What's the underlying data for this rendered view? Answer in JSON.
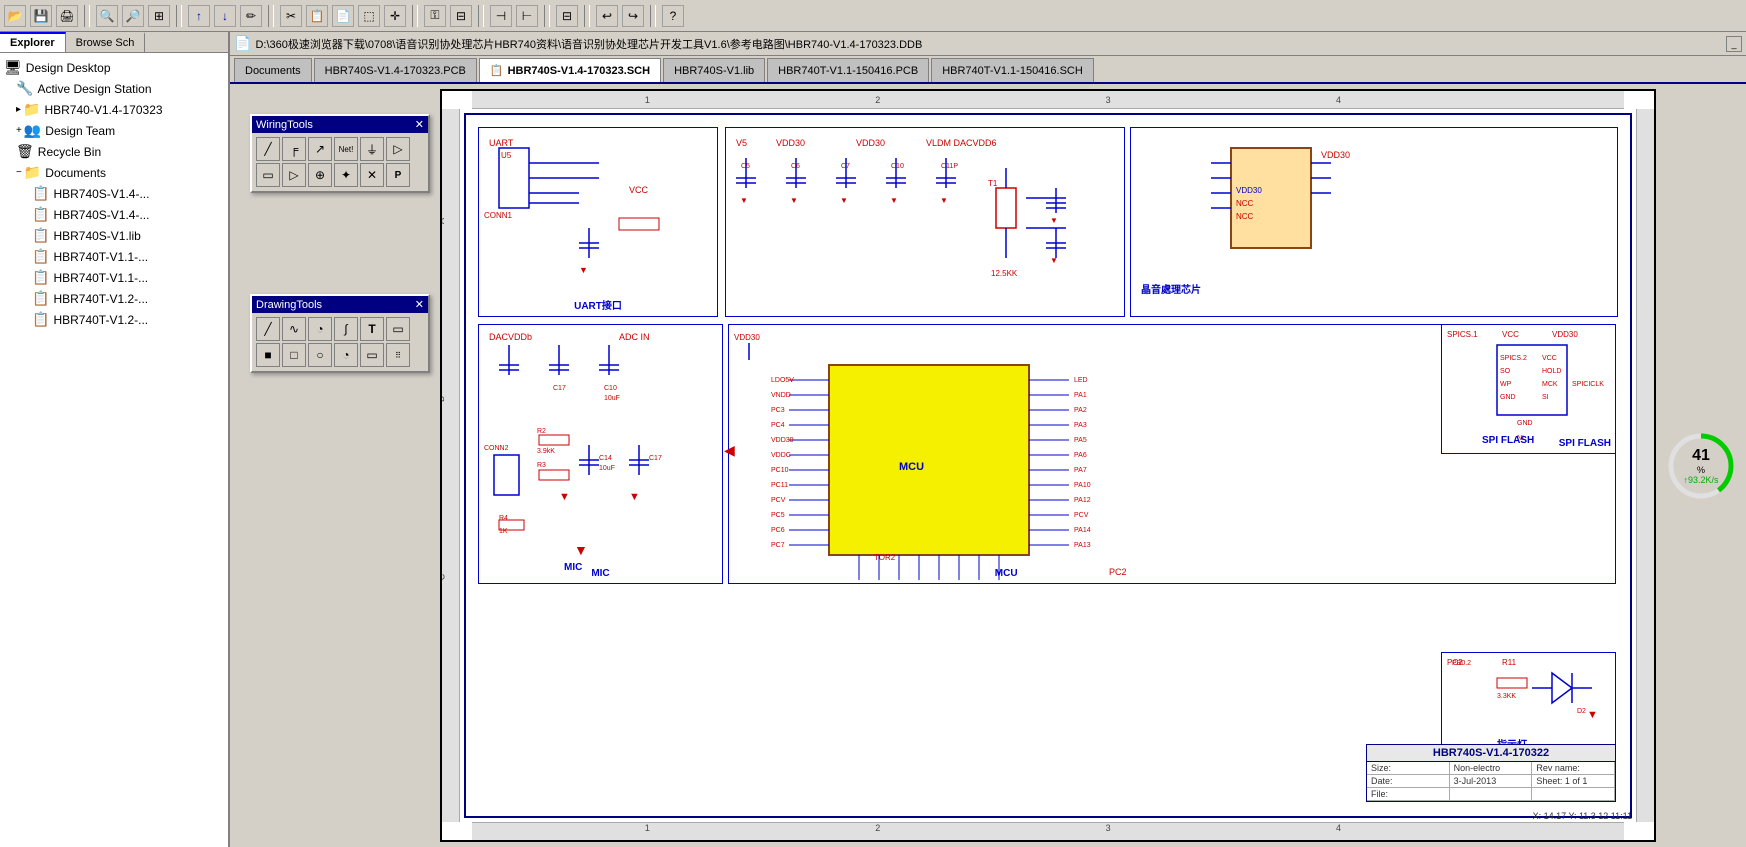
{
  "toolbar": {
    "buttons": [
      {
        "name": "open-icon",
        "symbol": "📂"
      },
      {
        "name": "save-icon",
        "symbol": "💾"
      },
      {
        "name": "print-icon",
        "symbol": "🖨"
      },
      {
        "name": "zoom-in-icon",
        "symbol": "🔍"
      },
      {
        "name": "zoom-out-icon",
        "symbol": "🔎"
      },
      {
        "name": "zoom-fit-icon",
        "symbol": "⊞"
      },
      {
        "name": "up-arrow-icon",
        "symbol": "↑"
      },
      {
        "name": "pencil-icon",
        "symbol": "✏"
      },
      {
        "name": "undo-icon",
        "symbol": "↩"
      },
      {
        "name": "redo-icon",
        "symbol": "↪"
      },
      {
        "name": "help-icon",
        "symbol": "?"
      }
    ]
  },
  "sidebar": {
    "tabs": [
      {
        "label": "Explorer",
        "active": true
      },
      {
        "label": "Browse Sch",
        "active": false
      }
    ],
    "tree": [
      {
        "label": "Design Desktop",
        "level": 0,
        "icon": "🖥",
        "expand": ""
      },
      {
        "label": "Active Design Station",
        "level": 1,
        "icon": "🔧",
        "expand": ""
      },
      {
        "label": "HBR740-V1.4-170323",
        "level": 1,
        "icon": "📁",
        "expand": ""
      },
      {
        "label": "Design Team",
        "level": 1,
        "icon": "👥",
        "expand": "+"
      },
      {
        "label": "Recycle Bin",
        "level": 1,
        "icon": "🗑",
        "expand": ""
      },
      {
        "label": "Documents",
        "level": 1,
        "icon": "📁",
        "expand": "-"
      },
      {
        "label": "HBR740S-V1.4-...",
        "level": 2,
        "icon": "📋",
        "expand": ""
      },
      {
        "label": "HBR740S-V1.4-...",
        "level": 2,
        "icon": "📋",
        "expand": ""
      },
      {
        "label": "HBR740S-V1.lib",
        "level": 2,
        "icon": "📋",
        "expand": ""
      },
      {
        "label": "HBR740T-V1.1-...",
        "level": 2,
        "icon": "📋",
        "expand": ""
      },
      {
        "label": "HBR740T-V1.1-...",
        "level": 2,
        "icon": "📋",
        "expand": ""
      },
      {
        "label": "HBR740T-V1.2-...",
        "level": 2,
        "icon": "📋",
        "expand": ""
      },
      {
        "label": "HBR740T-V1.2-...",
        "level": 2,
        "icon": "📋",
        "expand": ""
      }
    ]
  },
  "path_bar": {
    "path": "D:\\360极速浏览器下载\\0708\\语音识别协处理芯片HBR740资料\\语音识别协处理芯片开发工具V1.6\\参考电路图\\HBR740-V1.4-170323.DDB"
  },
  "doc_tabs": [
    {
      "label": "Documents",
      "active": false,
      "icon": ""
    },
    {
      "label": "HBR740S-V1.4-170323.PCB",
      "active": false,
      "icon": ""
    },
    {
      "label": "HBR740S-V1.4-170323.SCH",
      "active": true,
      "icon": "📋"
    },
    {
      "label": "HBR740S-V1.lib",
      "active": false,
      "icon": ""
    },
    {
      "label": "HBR740T-V1.1-150416.PCB",
      "active": false,
      "icon": ""
    },
    {
      "label": "HBR740T-V1.1-150416.SCH",
      "active": false,
      "icon": ""
    }
  ],
  "wiring_tools": {
    "title": "WiringTools",
    "tools": [
      {
        "name": "wire-tool",
        "symbol": "╱"
      },
      {
        "name": "bus-tool",
        "symbol": "╒"
      },
      {
        "name": "bus-entry-tool",
        "symbol": "↗"
      },
      {
        "name": "net-label-tool",
        "symbol": "Net!"
      },
      {
        "name": "power-tool",
        "symbol": "⏚"
      },
      {
        "name": "port-tool",
        "symbol": "▷"
      },
      {
        "name": "rect-tool",
        "symbol": "▭"
      },
      {
        "name": "poly-tool",
        "symbol": "▷"
      },
      {
        "name": "bus-branch-tool",
        "symbol": "⊕"
      },
      {
        "name": "junction-tool",
        "symbol": "✦"
      },
      {
        "name": "no-connect-tool",
        "symbol": "✕"
      },
      {
        "name": "pcb-layout-tool",
        "symbol": "P"
      }
    ]
  },
  "drawing_tools": {
    "title": "DrawingTools",
    "tools": [
      {
        "name": "line-tool",
        "symbol": "╱"
      },
      {
        "name": "bezier-tool",
        "symbol": "∿"
      },
      {
        "name": "arc-tool",
        "symbol": "◔"
      },
      {
        "name": "spline-tool",
        "symbol": "∫"
      },
      {
        "name": "text-tool",
        "symbol": "T"
      },
      {
        "name": "rect2-tool",
        "symbol": "▭"
      },
      {
        "name": "square-tool",
        "symbol": "■"
      },
      {
        "name": "rect3-tool",
        "symbol": "□"
      },
      {
        "name": "ellipse-tool",
        "symbol": "○"
      },
      {
        "name": "pie-tool",
        "symbol": "◔"
      },
      {
        "name": "roundrect-tool",
        "symbol": "▭"
      },
      {
        "name": "array-tool",
        "symbol": "⠿"
      }
    ]
  },
  "progress": {
    "percent": 41,
    "speed": "↑93.2K/s",
    "color": "#00cc00"
  },
  "circuit_blocks": {
    "uart_label": "UART接口",
    "mic_label": "MIC",
    "mcu_label": "MCU",
    "spi_flash_label": "SPI FLASH",
    "crystal_label": "晶音處理芯片",
    "led_label": "指示灯"
  },
  "title_block": {
    "title": "HBR740S-V1.4-170322",
    "rows": [
      {
        "col1": "Size:",
        "col2": "Non-electro",
        "col3": "Rev name:"
      },
      {
        "col1": "Date:",
        "col2": "3-Jul-2013",
        "col3": "Sheet: 1 of 1"
      },
      {
        "col1": "File:",
        "col2": "",
        "col3": ""
      }
    ]
  },
  "status_bar": {
    "text": "X: 14.17  Y: 11.3  12 11:11"
  }
}
